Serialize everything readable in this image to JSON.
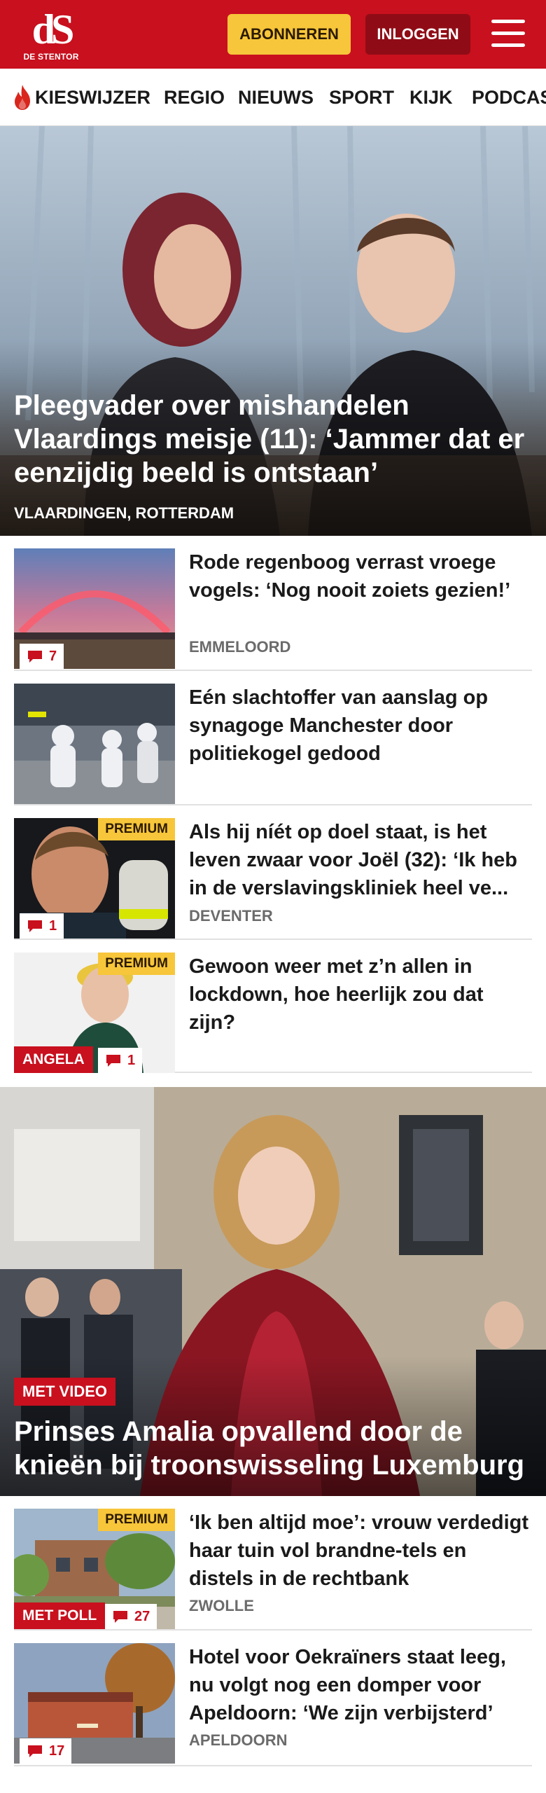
{
  "header": {
    "logo_mark": "dS",
    "logo_sub": "DE STENTOR",
    "subscribe_label": "ABONNEREN",
    "login_label": "INLOGGEN",
    "colors": {
      "brand": "#c8101e",
      "subscribe": "#f7c63a",
      "login": "#8f0c16"
    }
  },
  "nav": {
    "items": [
      "KIESWIJZER",
      "REGIO",
      "NIEUWS",
      "SPORT",
      "KIJK",
      "PODCAS"
    ]
  },
  "hero": {
    "title": "Pleegvader over mishandelen Vlaardings meisje (11): ‘Jammer dat er eenzijdig beeld is ontstaan’",
    "location": "VLAARDINGEN, ROTTERDAM"
  },
  "articles": [
    {
      "title": "Rode regenboog verrast vroege vogels: ‘Nog nooit zoiets gezien!’",
      "location": "EMMELOORD",
      "comments": "7"
    },
    {
      "title": "Eén slachtoffer van aanslag op synagoge Manchester door politiekogel gedood"
    },
    {
      "title": "Als hij níét op doel staat, is het leven zwaar voor Joël (32): ‘Ik heb in de verslavingskliniek heel ve...",
      "location": "DEVENTER",
      "comments": "1",
      "badge": "PREMIUM"
    },
    {
      "title": "Gewoon weer met z’n allen in lockdown, hoe heerlijk zou dat zijn?",
      "comments": "1",
      "badge": "PREMIUM",
      "tag": "ANGELA"
    }
  ],
  "feature": {
    "tag": "MET VIDEO",
    "title": "Prinses Amalia opvallend door de knieën bij troonswisseling Luxemburg"
  },
  "articles2": [
    {
      "title": "‘Ik ben altijd moe’: vrouw verdedigt haar tuin vol brandne-tels en distels in de rechtbank",
      "location": "ZWOLLE",
      "comments": "27",
      "badge": "PREMIUM",
      "tag": "MET POLL"
    },
    {
      "title": "Hotel voor Oekraïners staat leeg, nu volgt nog een domper voor Apeldoorn: ‘We zijn verbijsterd’",
      "location": "APELDOORN",
      "comments": "17"
    }
  ]
}
